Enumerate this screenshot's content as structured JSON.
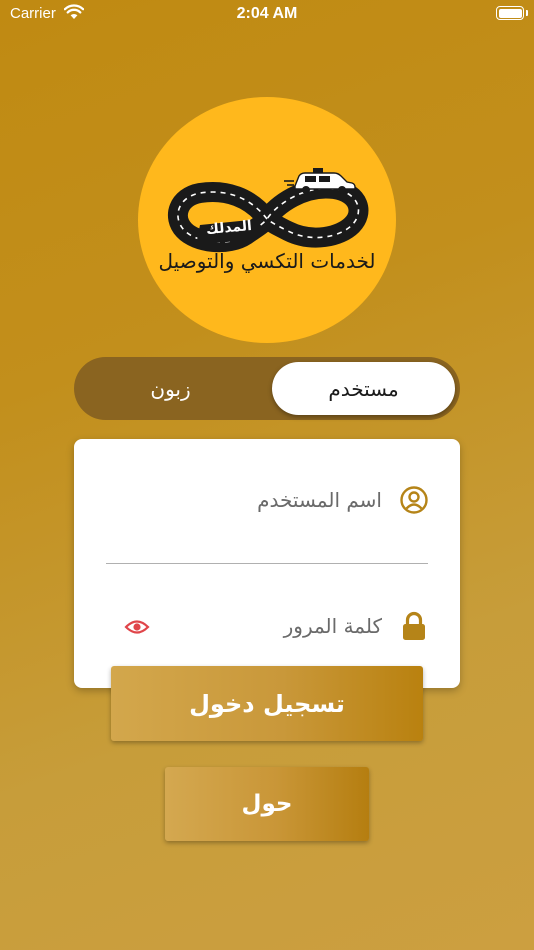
{
  "status_bar": {
    "carrier": "Carrier",
    "time": "2:04 AM"
  },
  "logo": {
    "brand": "المدلك",
    "tagline": "لخدمات التكسي والتوصيل",
    "background_color": "#ffb81c"
  },
  "segmented_control": {
    "selected_label": "مستخدم",
    "other_label": "زبون"
  },
  "login_form": {
    "username_placeholder": "اسم المستخدم",
    "password_placeholder": "كلمة المرور",
    "icons": [
      "user-circle-icon",
      "lock-icon",
      "eye-icon"
    ]
  },
  "buttons": {
    "login_label": "تسجيل دخول",
    "about_label": "حول"
  },
  "colors": {
    "background": "#c28f1c",
    "accent": "#ffb81c",
    "icon_gold": "#b58418",
    "eye_red": "#e0454a"
  }
}
